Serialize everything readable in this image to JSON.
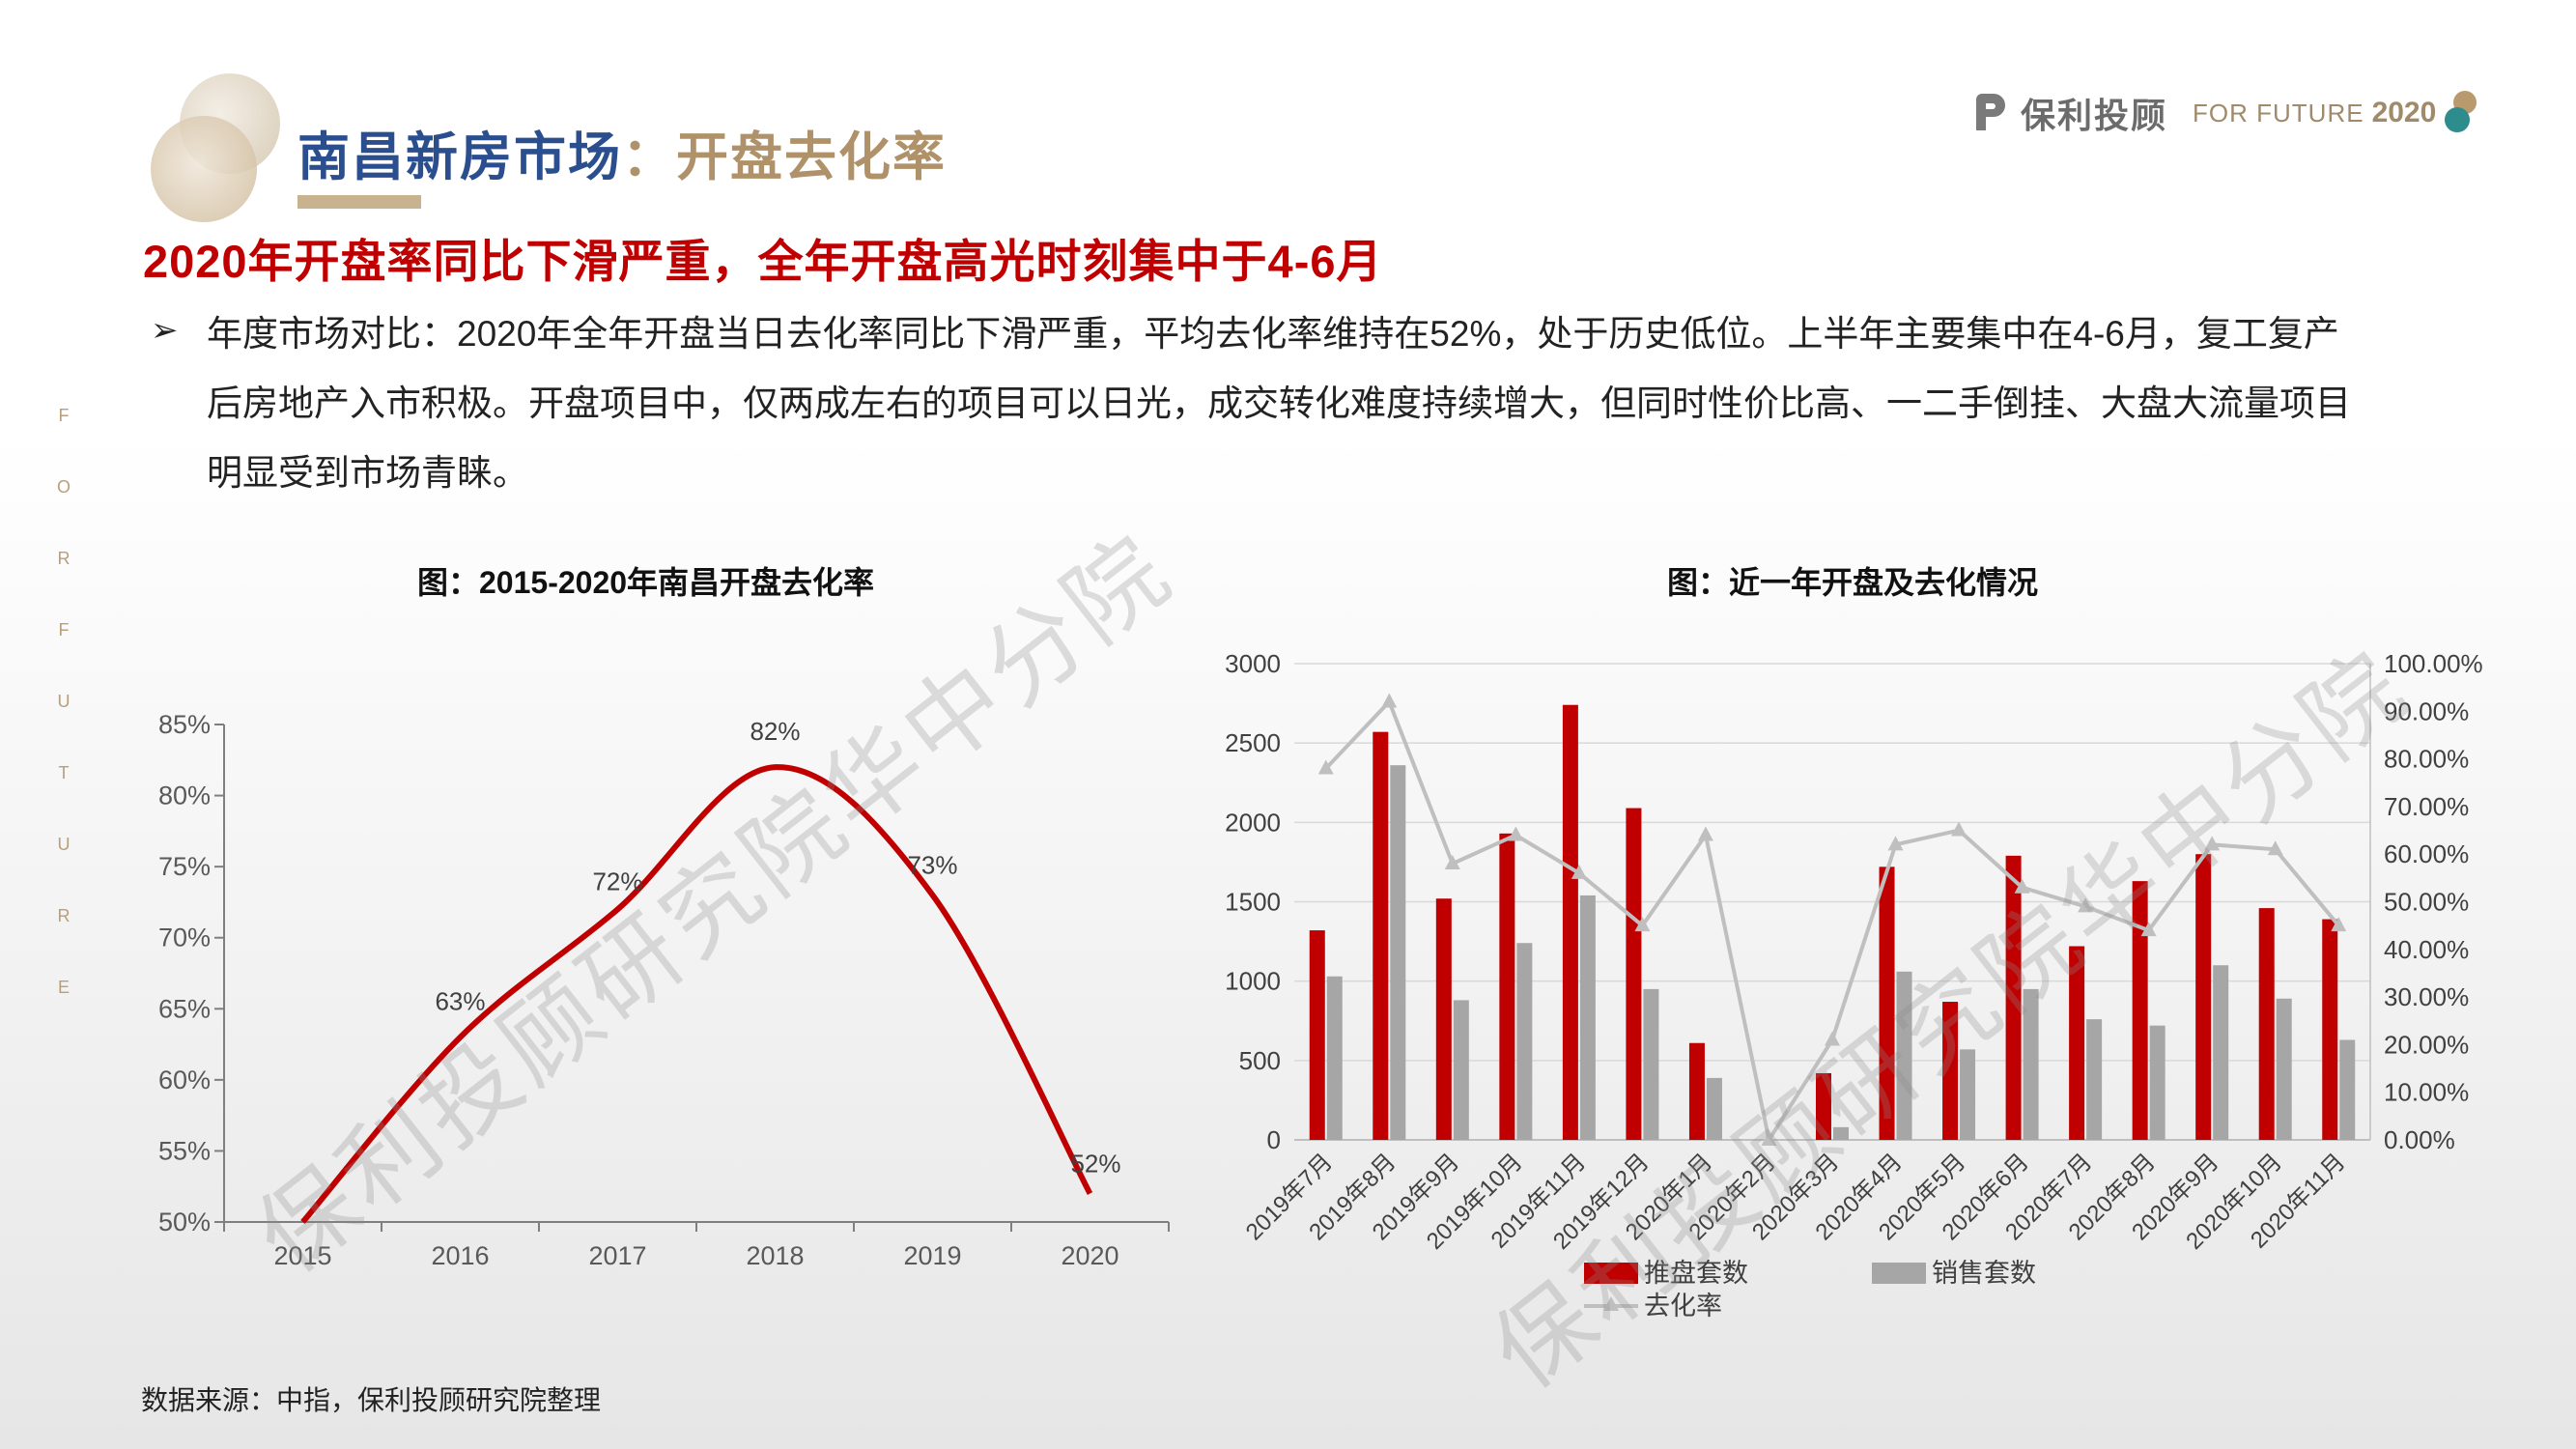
{
  "header": {
    "title_part1": "南昌新房市场",
    "title_part2": "：开盘去化率",
    "logo_name": "保利投顾",
    "logo_tagline": "FOR FUTURE",
    "logo_year": "2020"
  },
  "side_letters": [
    "F",
    "O",
    "R",
    "F",
    "U",
    "T",
    "U",
    "R",
    "E"
  ],
  "headline": "2020年开盘率同比下滑严重，全年开盘高光时刻集中于4-6月",
  "bullet": {
    "line1": "年度市场对比：2020年全年开盘当日去化率同比下滑严重，平均去化率维持在52%，处于历史低位。上半年主要集中在4-6月，复工复产",
    "line2": "后房地产入市积极。开盘项目中，仅两成左右的项目可以日光，成交转化难度持续增大，但同时性价比高、一二手倒挂、大盘大流量项目",
    "line3": "明显受到市场青睐。"
  },
  "source": "数据来源：中指，保利投顾研究院整理",
  "watermark": "保利投顾研究院华中分院",
  "colors": {
    "red": "#c00000",
    "gray": "#a6a6a6",
    "line_gray": "#bfbfbf",
    "title_blue": "#2b4f8e",
    "title_gold": "#b0926a"
  },
  "chart_data": [
    {
      "type": "line",
      "title": "图：2015-2020年南昌开盘去化率",
      "categories": [
        "2015",
        "2016",
        "2017",
        "2018",
        "2019",
        "2020"
      ],
      "values": [
        0.5,
        0.63,
        0.72,
        0.82,
        0.73,
        0.52
      ],
      "data_labels": [
        "",
        "63%",
        "72%",
        "82%",
        "73%",
        "52%"
      ],
      "y_ticks": [
        "50%",
        "55%",
        "60%",
        "65%",
        "70%",
        "75%",
        "80%",
        "85%"
      ],
      "ylim": [
        0.5,
        0.85
      ],
      "smooth": true,
      "color": "#c00000"
    },
    {
      "type": "bar",
      "title": "图：近一年开盘及去化情况",
      "categories": [
        "2019年7月",
        "2019年8月",
        "2019年9月",
        "2019年10月",
        "2019年11月",
        "2019年12月",
        "2020年1月",
        "2020年2月",
        "2020年3月",
        "2020年4月",
        "2020年5月",
        "2020年6月",
        "2020年7月",
        "2020年8月",
        "2020年9月",
        "2020年10月",
        "2020年11月"
      ],
      "series": [
        {
          "name": "推盘套数",
          "color": "#c00000",
          "axis": "left",
          "values": [
            1320,
            2570,
            1520,
            1930,
            2740,
            2090,
            610,
            0,
            420,
            1720,
            870,
            1790,
            1220,
            1630,
            1800,
            1460,
            1390
          ]
        },
        {
          "name": "销售套数",
          "color": "#a6a6a6",
          "axis": "left",
          "values": [
            1030,
            2360,
            880,
            1240,
            1540,
            950,
            390,
            0,
            80,
            1060,
            570,
            950,
            760,
            720,
            1100,
            890,
            630
          ]
        },
        {
          "name": "去化率",
          "color": "#bfbfbf",
          "axis": "right",
          "kind": "line",
          "values": [
            0.78,
            0.92,
            0.58,
            0.64,
            0.56,
            0.45,
            0.64,
            0.0,
            0.21,
            0.62,
            0.65,
            0.53,
            0.49,
            0.44,
            0.62,
            0.61,
            0.45
          ]
        }
      ],
      "y_left_ticks": [
        "0",
        "500",
        "1000",
        "1500",
        "2000",
        "2500",
        "3000"
      ],
      "ylim_left": [
        0,
        3000
      ],
      "y_right_ticks": [
        "0.00%",
        "10.00%",
        "20.00%",
        "30.00%",
        "40.00%",
        "50.00%",
        "60.00%",
        "70.00%",
        "80.00%",
        "90.00%",
        "100.00%"
      ],
      "ylim_right": [
        0,
        1
      ],
      "legend": [
        "推盘套数",
        "销售套数",
        "去化率"
      ],
      "legend_position": "bottom",
      "grid": true
    }
  ]
}
